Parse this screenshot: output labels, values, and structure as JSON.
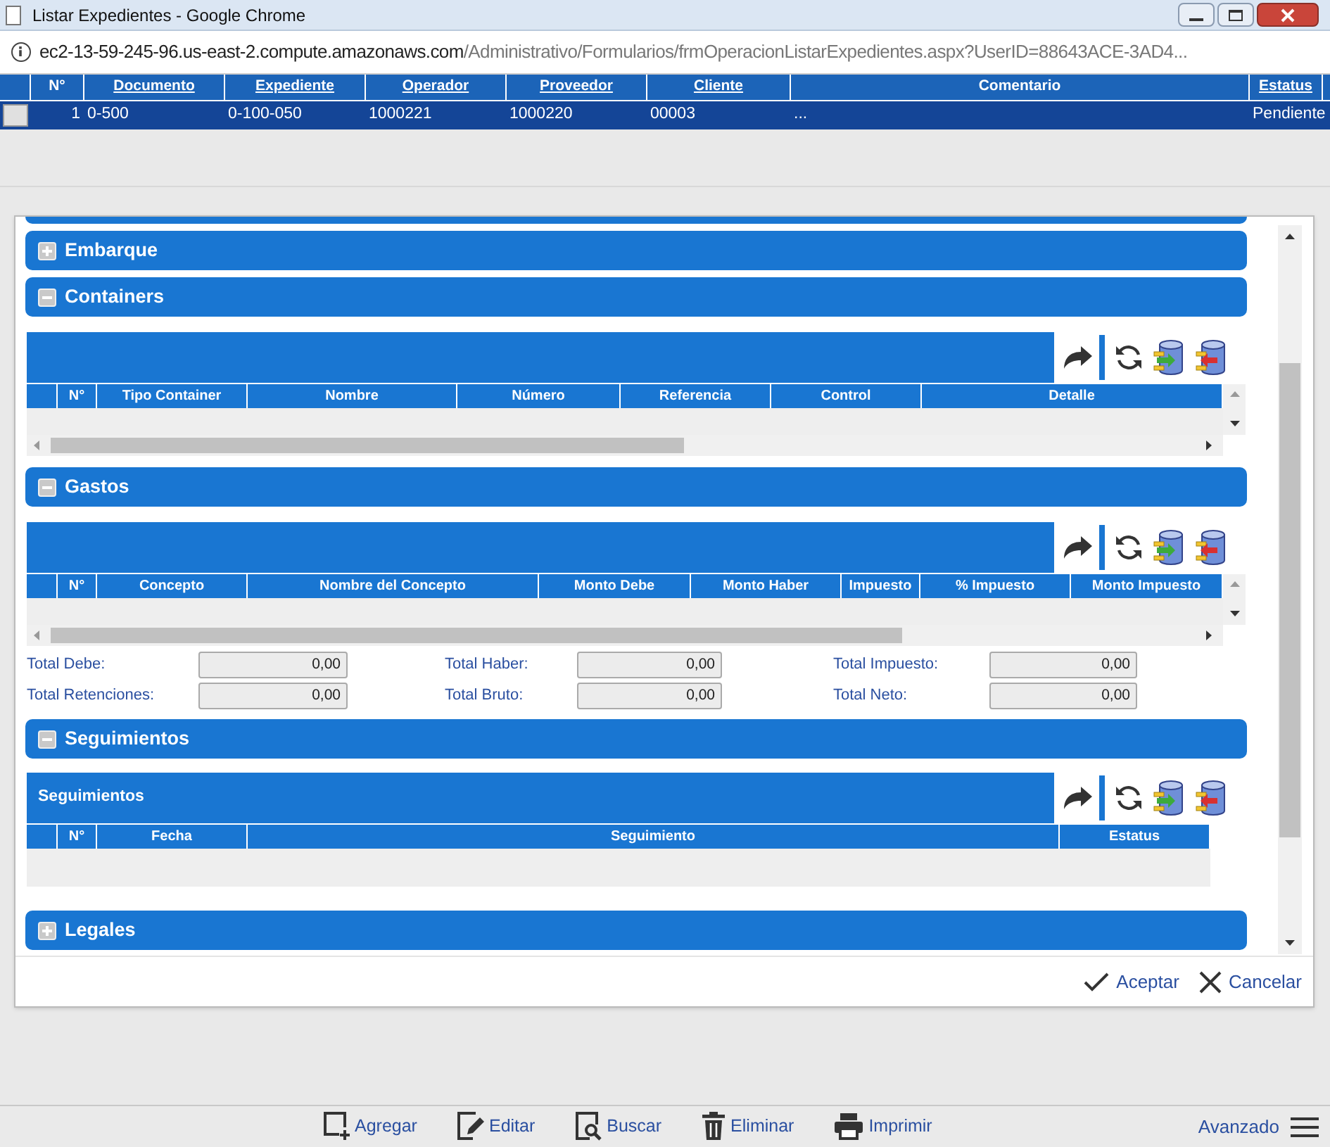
{
  "window": {
    "title": "Listar Expedientes - Google Chrome"
  },
  "address_bar": {
    "host": "ec2-13-59-245-96.us-east-2.compute.amazonaws.com",
    "path": "/Administrativo/Formularios/frmOperacionListarExpedientes.aspx?UserID=88643ACE-3AD4..."
  },
  "list": {
    "columns": [
      {
        "label": "N°",
        "sortable": false
      },
      {
        "label": "Documento",
        "sortable": true
      },
      {
        "label": "Expediente",
        "sortable": true
      },
      {
        "label": "Operador",
        "sortable": true
      },
      {
        "label": "Proveedor",
        "sortable": true
      },
      {
        "label": "Cliente",
        "sortable": true
      },
      {
        "label": "Comentario",
        "sortable": false
      },
      {
        "label": "Estatus",
        "sortable": true
      }
    ],
    "rows": [
      {
        "selected": true,
        "cells": [
          "1",
          "0-500",
          "0-100-050",
          "1000221",
          "1000220",
          "00003",
          "...",
          "Pendiente"
        ]
      }
    ]
  },
  "dialog": {
    "sections": [
      {
        "title": "Embarque",
        "expanded": false
      },
      {
        "title": "Containers",
        "expanded": true,
        "grid": {
          "columns": [
            "N°",
            "Tipo Container",
            "Nombre",
            "Número",
            "Referencia",
            "Control",
            "Detalle"
          ]
        }
      },
      {
        "title": "Gastos",
        "expanded": true,
        "grid": {
          "columns": [
            "N°",
            "Concepto",
            "Nombre del Concepto",
            "Monto Debe",
            "Monto Haber",
            "Impuesto",
            "% Impuesto",
            "Monto Impuesto"
          ]
        },
        "totals": [
          {
            "label": "Total Debe:",
            "value": "0,00"
          },
          {
            "label": "Total Haber:",
            "value": "0,00"
          },
          {
            "label": "Total Impuesto:",
            "value": "0,00"
          },
          {
            "label": "Total Retenciones:",
            "value": "0,00"
          },
          {
            "label": "Total Bruto:",
            "value": "0,00"
          },
          {
            "label": "Total Neto:",
            "value": "0,00"
          }
        ]
      },
      {
        "title": "Seguimientos",
        "expanded": true,
        "grid": {
          "caption": "Seguimientos",
          "columns": [
            "N°",
            "Fecha",
            "Seguimiento",
            "Estatus"
          ]
        }
      },
      {
        "title": "Legales",
        "expanded": false
      }
    ],
    "buttons": [
      {
        "label": "Aceptar",
        "kind": "accept"
      },
      {
        "label": "Cancelar",
        "kind": "cancel"
      }
    ]
  },
  "toolbar": {
    "buttons": [
      {
        "label": "Agregar",
        "kind": "add"
      },
      {
        "label": "Editar",
        "kind": "edit"
      },
      {
        "label": "Buscar",
        "kind": "search"
      },
      {
        "label": "Eliminar",
        "kind": "delete"
      },
      {
        "label": "Imprimir",
        "kind": "print"
      }
    ],
    "advanced": "Avanzado"
  }
}
